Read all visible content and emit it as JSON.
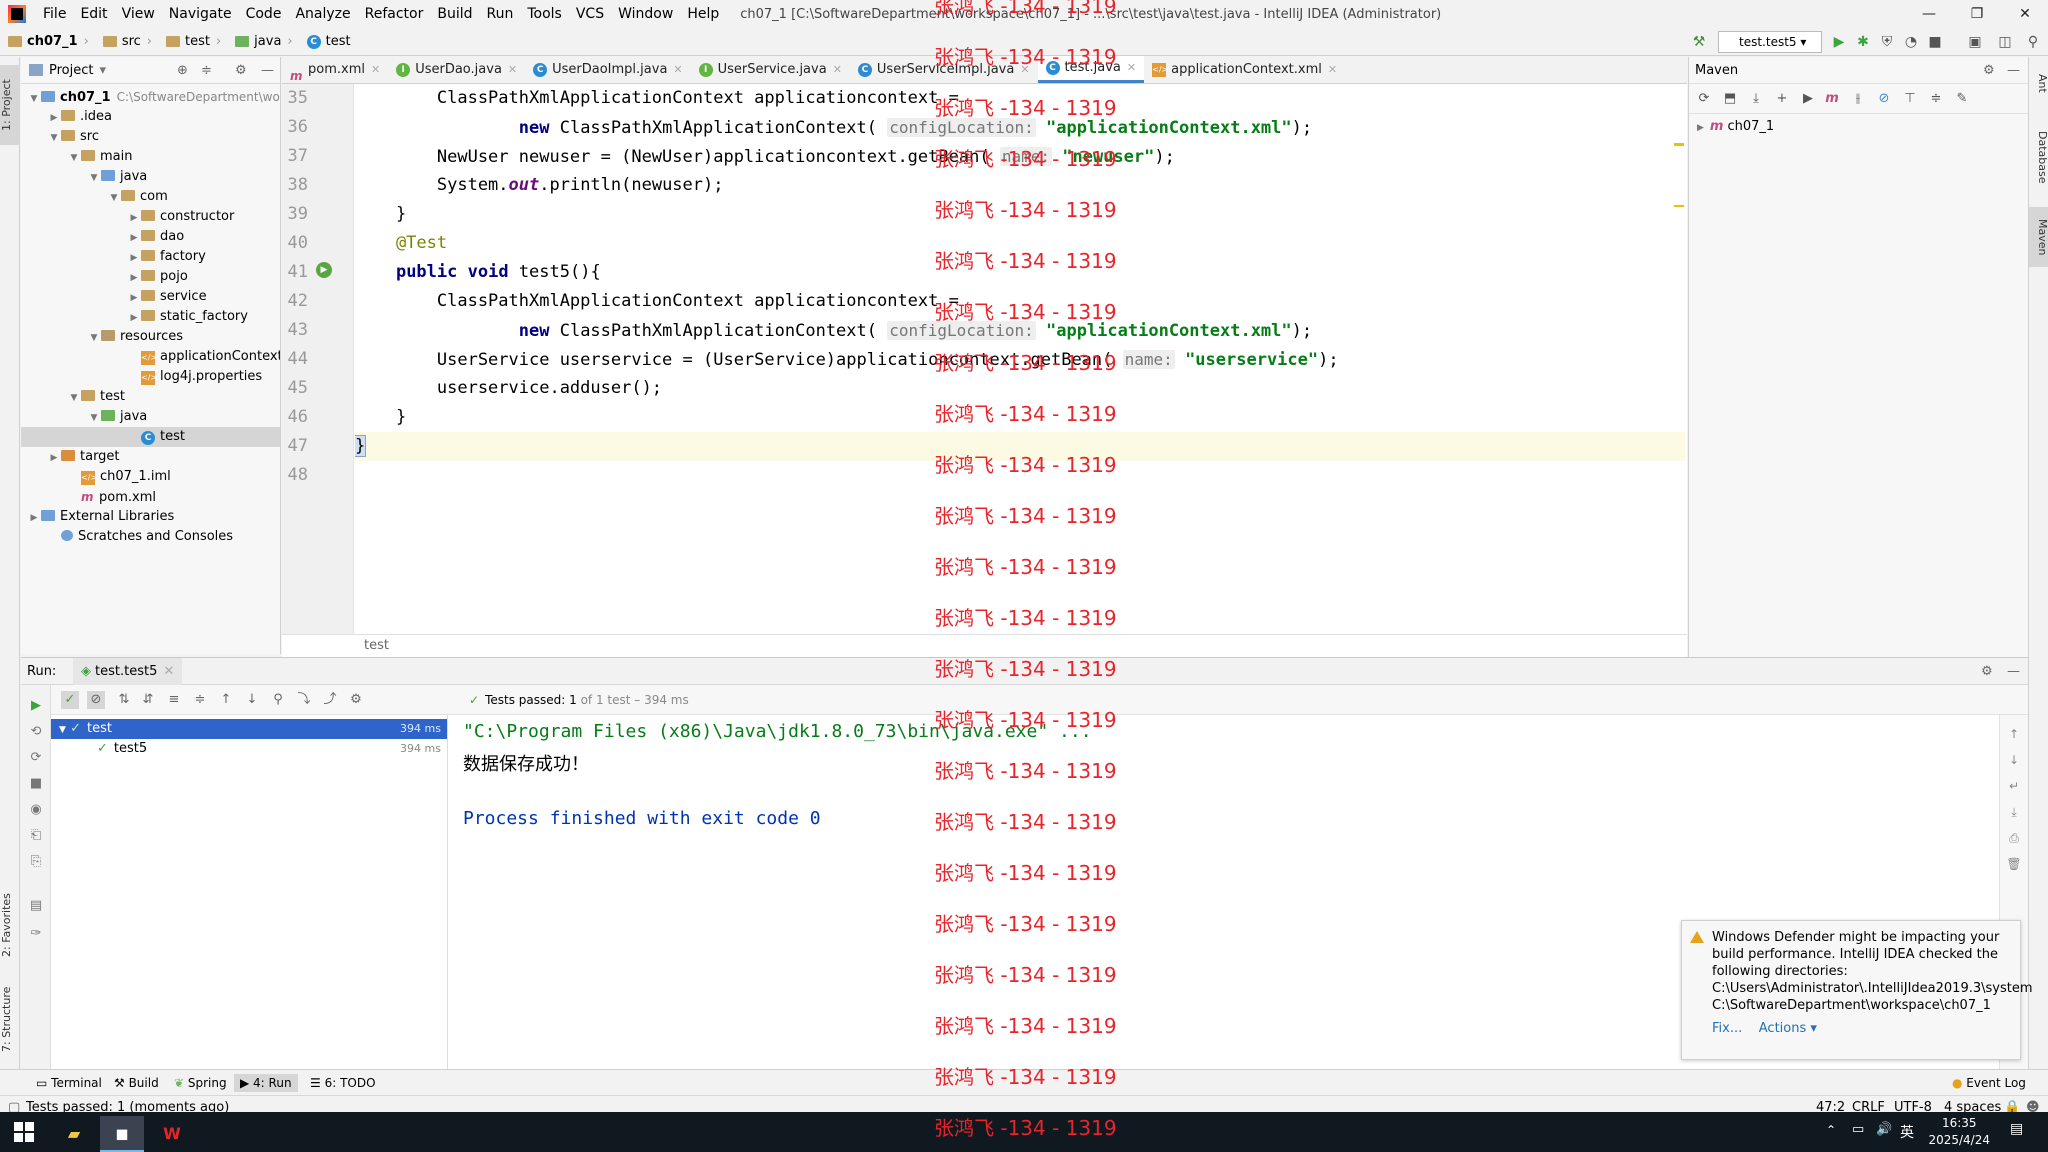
{
  "window": {
    "title": "ch07_1 [C:\\SoftwareDepartment\\workspace\\ch07_1] - ...\\src\\test\\java\\test.java - IntelliJ IDEA (Administrator)",
    "menu": [
      "File",
      "Edit",
      "View",
      "Navigate",
      "Code",
      "Analyze",
      "Refactor",
      "Build",
      "Run",
      "Tools",
      "VCS",
      "Window",
      "Help"
    ],
    "controls": {
      "minimize": "—",
      "restore": "❐",
      "close": "✕"
    }
  },
  "breadcrumbs": [
    "ch07_1",
    "src",
    "test",
    "java",
    "test"
  ],
  "run_config": "test.test5",
  "project": {
    "title": "Project",
    "tree": [
      {
        "label": "ch07_1",
        "path": "C:\\SoftwareDepartment\\work",
        "depth": 0,
        "arrow": "▼",
        "icon": "blue",
        "bold": true
      },
      {
        "label": ".idea",
        "depth": 1,
        "arrow": "▶",
        "icon": "folder"
      },
      {
        "label": "src",
        "depth": 1,
        "arrow": "▼",
        "icon": "folder"
      },
      {
        "label": "main",
        "depth": 2,
        "arrow": "▼",
        "icon": "folder"
      },
      {
        "label": "java",
        "depth": 3,
        "arrow": "▼",
        "icon": "blue"
      },
      {
        "label": "com",
        "depth": 4,
        "arrow": "▼",
        "icon": "folder"
      },
      {
        "label": "constructor",
        "depth": 5,
        "arrow": "▶",
        "icon": "folder"
      },
      {
        "label": "dao",
        "depth": 5,
        "arrow": "▶",
        "icon": "folder"
      },
      {
        "label": "factory",
        "depth": 5,
        "arrow": "▶",
        "icon": "folder"
      },
      {
        "label": "pojo",
        "depth": 5,
        "arrow": "▶",
        "icon": "folder"
      },
      {
        "label": "service",
        "depth": 5,
        "arrow": "▶",
        "icon": "folder"
      },
      {
        "label": "static_factory",
        "depth": 5,
        "arrow": "▶",
        "icon": "folder"
      },
      {
        "label": "resources",
        "depth": 3,
        "arrow": "▼",
        "icon": "res"
      },
      {
        "label": "applicationContext.xml",
        "depth": 5,
        "arrow": "",
        "icon": "xml"
      },
      {
        "label": "log4j.properties",
        "depth": 5,
        "arrow": "",
        "icon": "xml"
      },
      {
        "label": "test",
        "depth": 2,
        "arrow": "▼",
        "icon": "folder"
      },
      {
        "label": "java",
        "depth": 3,
        "arrow": "▼",
        "icon": "green"
      },
      {
        "label": "test",
        "depth": 5,
        "arrow": "",
        "icon": "class",
        "selected": true
      },
      {
        "label": "target",
        "depth": 1,
        "arrow": "▶",
        "icon": "orange"
      },
      {
        "label": "ch07_1.iml",
        "depth": 2,
        "arrow": "",
        "icon": "xml"
      },
      {
        "label": "pom.xml",
        "depth": 2,
        "arrow": "",
        "icon": "m"
      },
      {
        "label": "External Libraries",
        "depth": 0,
        "arrow": "▶",
        "icon": "lib"
      },
      {
        "label": "Scratches and Consoles",
        "depth": 1,
        "arrow": "",
        "icon": "scratch"
      }
    ]
  },
  "editor_tabs": [
    {
      "label": "pom.xml",
      "icon": "m"
    },
    {
      "label": "UserDao.java",
      "icon": "I"
    },
    {
      "label": "UserDaoImpl.java",
      "icon": "C"
    },
    {
      "label": "UserService.java",
      "icon": "I"
    },
    {
      "label": "UserServiceImpl.java",
      "icon": "C"
    },
    {
      "label": "test.java",
      "icon": "C",
      "active": true
    },
    {
      "label": "applicationContext.xml",
      "icon": "xml"
    }
  ],
  "line_numbers": [
    "35",
    "36",
    "37",
    "38",
    "39",
    "40",
    "41",
    "42",
    "43",
    "44",
    "45",
    "46",
    "47",
    "48"
  ],
  "code": {
    "l35": "        ClassPathXmlApplicationContext applicationcontext =",
    "l36_new": "new",
    "l36_a": " ClassPathXmlApplicationContext(",
    "l36_hint": "configLocation:",
    "l36_str": "\"applicationContext.xml\"",
    "l36_end": ");",
    "l37_a": "        NewUser newuser = (NewUser)applicationcontext.getBean(",
    "l37_hint": "name:",
    "l37_str": "\"newuser\"",
    "l37_end": ");",
    "l38_a": "        System.",
    "l38_field": "out",
    "l38_b": ".println(newuser);",
    "l39": "    }",
    "l40": "    @Test",
    "l41_kw1": "public",
    "l41_kw2": "void",
    "l41_b": " test5(){",
    "l42": "        ClassPathXmlApplicationContext applicationcontext =",
    "l43_new": "new",
    "l43_a": " ClassPathXmlApplicationContext(",
    "l43_hint": "configLocation:",
    "l43_str": "\"applicationContext.xml\"",
    "l43_end": ");",
    "l44_a": "        UserService userservice = (UserService)applicationcontext.getBean(",
    "l44_hint": "name:",
    "l44_str": "\"userservice\"",
    "l44_end": ");",
    "l45": "        userservice.adduser();",
    "l46": "    }",
    "l47": "}"
  },
  "editor_breadcrumb": "test",
  "maven": {
    "title": "Maven",
    "root": "ch07_1"
  },
  "run": {
    "label": "Run:",
    "tab": "test.test5",
    "status": "Tests passed:",
    "status_count": "1",
    "status_rest": "of 1 test – 394 ms",
    "tree": [
      {
        "label": "test",
        "time": "394 ms",
        "selected": true
      },
      {
        "label": "test5",
        "time": "394 ms"
      }
    ],
    "console": [
      "\"C:\\Program Files (x86)\\Java\\jdk1.8.0_73\\bin\\java.exe\" ...",
      "数据保存成功！",
      "",
      "Process finished with exit code 0"
    ]
  },
  "notification": {
    "text": "Windows Defender might be impacting your build performance. IntelliJ IDEA checked the following directories:",
    "dir1": "C:\\Users\\Administrator\\.IntelliJIdea2019.3\\system",
    "dir2": "C:\\SoftwareDepartment\\workspace\\ch07_1",
    "fix": "Fix...",
    "actions": "Actions ▾"
  },
  "bottom_tabs": [
    "Terminal",
    "Build",
    "Spring",
    "4: Run",
    "6: TODO"
  ],
  "event_log": "Event Log",
  "statusbar": {
    "message": "Tests passed: 1 (moments ago)",
    "position": "47:2",
    "line_sep": "CRLF",
    "encoding": "UTF-8",
    "indent": "4 spaces"
  },
  "side_tabs": {
    "left_top": "1: Project",
    "left_fav": "2: Favorites",
    "left_struct": "7: Structure",
    "right_ant": "Ant",
    "right_db": "Database",
    "right_maven": "Maven"
  },
  "taskbar": {
    "time": "16:35",
    "date": "2025/4/24",
    "ime": "英"
  },
  "watermark": "张鸿飞 -134 - 1319",
  "colors": {
    "keyword": "#000080",
    "string": "#067d17",
    "annotation": "#808000",
    "selection": "#2f65ca",
    "watermark": "#e8242b"
  }
}
